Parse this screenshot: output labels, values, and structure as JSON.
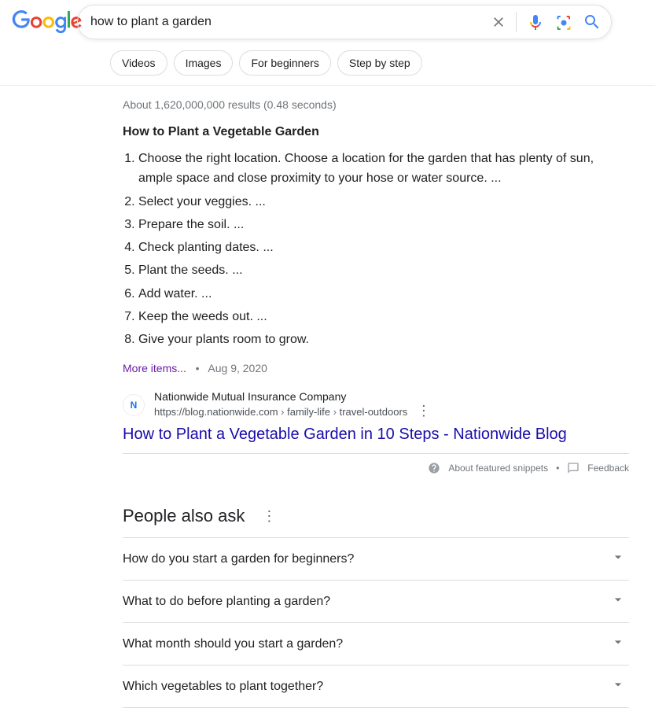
{
  "search": {
    "query": "how to plant a garden"
  },
  "filters": [
    "Videos",
    "Images",
    "For beginners",
    "Step by step"
  ],
  "stats": "About 1,620,000,000 results (0.48 seconds) ",
  "snippet": {
    "title": "How to Plant a Vegetable Garden",
    "steps": [
      "Choose the right location. Choose a location for the garden that has plenty of sun, ample space and close proximity to your hose or water source. ...",
      "Select your veggies. ...",
      "Prepare the soil. ...",
      "Check planting dates. ...",
      "Plant the seeds. ...",
      "Add water. ...",
      "Keep the weeds out. ...",
      "Give your plants room to grow."
    ],
    "more": "More items...",
    "bullet": "•",
    "date": "Aug 9, 2020"
  },
  "source": {
    "site": "Nationwide Mutual Insurance Company",
    "urlBase": "https://blog.nationwide.com",
    "crumb1": "family-life",
    "crumb2": "travel-outdoors",
    "sep": " › ",
    "title": "How to Plant a Vegetable Garden in 10 Steps - Nationwide Blog"
  },
  "footer": {
    "about": "About featured snippets",
    "dot": "•",
    "feedback": "Feedback"
  },
  "paa": {
    "title": "People also ask",
    "items": [
      "How do you start a garden for beginners?",
      "What to do before planting a garden?",
      "What month should you start a garden?",
      "Which vegetables to plant together?"
    ]
  }
}
